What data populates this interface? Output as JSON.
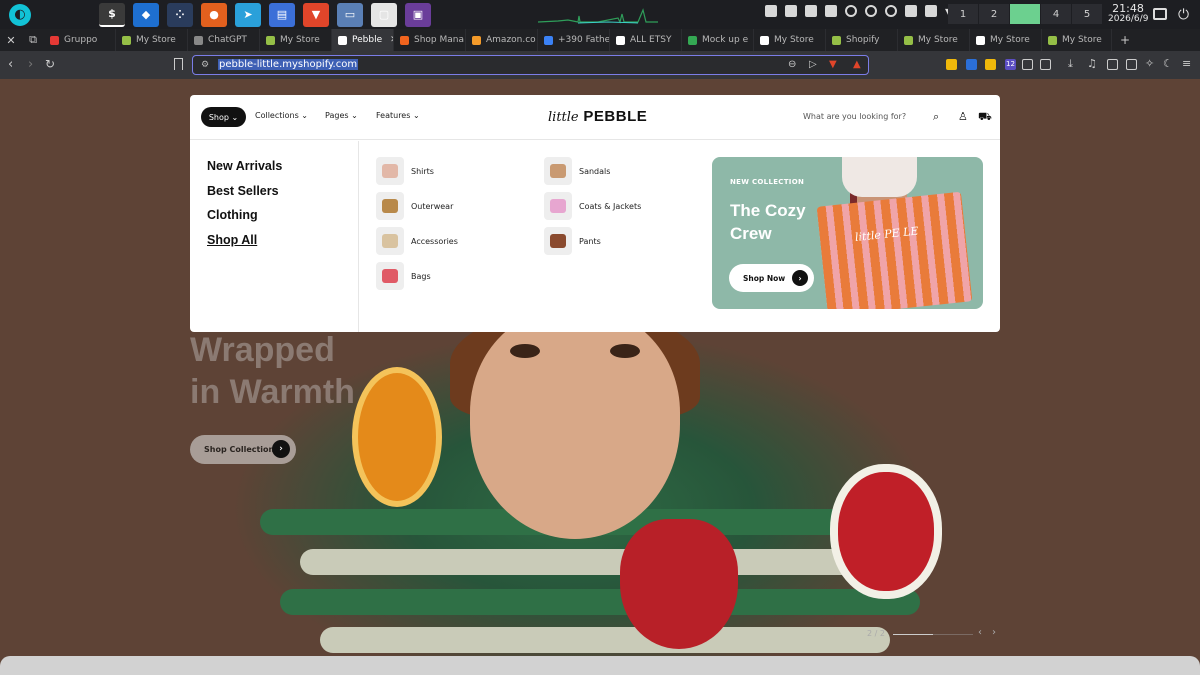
{
  "taskbar": {
    "apps": [
      {
        "name": "terminal-app",
        "glyph": "$",
        "color": "#3a3a3a"
      },
      {
        "name": "vscode-app",
        "glyph": "◆",
        "color": "#1e6fd0"
      },
      {
        "name": "nodes-app",
        "glyph": "⁘",
        "color": "#2a3c5c"
      },
      {
        "name": "firefox-app",
        "glyph": "●",
        "color": "#e2601e"
      },
      {
        "name": "telegram-app",
        "glyph": "➤",
        "color": "#2aa0da"
      },
      {
        "name": "notes-app",
        "glyph": "▤",
        "color": "#3b6fd8"
      },
      {
        "name": "brave-app",
        "glyph": "▼",
        "color": "#e0452a"
      },
      {
        "name": "files-app",
        "glyph": "▭",
        "color": "#5a7fb5"
      },
      {
        "name": "document-app",
        "glyph": "▢",
        "color": "#e5e5e5"
      },
      {
        "name": "screen-app",
        "glyph": "▣",
        "color": "#6a3d9a"
      }
    ],
    "workspaces": [
      "1",
      "2",
      "",
      "4",
      "5"
    ],
    "time": "21:48",
    "date": "2026/6/9"
  },
  "tabs": [
    {
      "label": "Gruppo",
      "color": "#e53935"
    },
    {
      "label": "My Store",
      "color": "#95bf47"
    },
    {
      "label": "ChatGPT",
      "color": "#888888"
    },
    {
      "label": "My Store",
      "color": "#95bf47"
    },
    {
      "label": "Pebble",
      "color": "#ffffff",
      "active": true
    },
    {
      "label": "Shop Mana",
      "color": "#f1641e"
    },
    {
      "label": "Amazon.co",
      "color": "#f49b2a"
    },
    {
      "label": "+390 Fathe",
      "color": "#3b82f6"
    },
    {
      "label": "ALL ETSY",
      "color": "#ffffff"
    },
    {
      "label": "Mock up e",
      "color": "#34a853"
    },
    {
      "label": "My Store",
      "color": "#ffffff"
    },
    {
      "label": "Shopify",
      "color": "#95bf47"
    },
    {
      "label": "My Store",
      "color": "#95bf47"
    },
    {
      "label": "My Store",
      "color": "#ffffff"
    },
    {
      "label": "My Store",
      "color": "#95bf47"
    }
  ],
  "address": {
    "url": "pebble-little.myshopify.com",
    "ext_badge": "12"
  },
  "store": {
    "nav": {
      "shop": "Shop",
      "collections": "Collections",
      "pages": "Pages",
      "features": "Features",
      "search_placeholder": "What are you looking for?"
    },
    "logo": {
      "script": "little",
      "bold": "PEBBLE"
    },
    "menu_left": [
      "New Arrivals",
      "Best Sellers",
      "Clothing",
      "Shop All"
    ],
    "categories_col1": [
      {
        "label": "Shirts",
        "swatch": "#e2b8a8"
      },
      {
        "label": "Outerwear",
        "swatch": "#b8894a"
      },
      {
        "label": "Accessories",
        "swatch": "#d9c3a0"
      },
      {
        "label": "Bags",
        "swatch": "#e05a66"
      }
    ],
    "categories_col2": [
      {
        "label": "Sandals",
        "swatch": "#c99a72"
      },
      {
        "label": "Coats & Jackets",
        "swatch": "#e7a6d0"
      },
      {
        "label": "Pants",
        "swatch": "#8a4a2e"
      }
    ],
    "promo": {
      "tag": "NEW COLLECTION",
      "title": "The Cozy Crew",
      "button": "Shop Now",
      "bag_text": "little PE    LE"
    },
    "hero": {
      "title_line1": "Wrapped",
      "title_line2": "in Warmth",
      "button": "Shop Collection",
      "slide_counter": "2 / 2"
    }
  }
}
